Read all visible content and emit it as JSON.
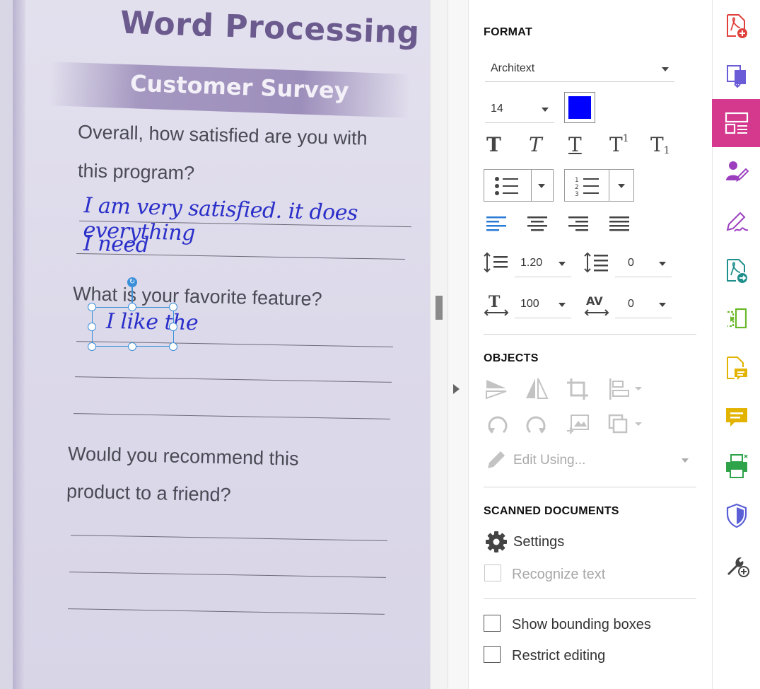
{
  "document": {
    "title": "Word Processing",
    "subtitle": "Customer Survey",
    "question1_line1": "Overall, how satisfied are you with",
    "question1_line2": "this program?",
    "answer1_line1": "I am very satisfied. it does everything",
    "answer1_line2": "I need",
    "question2": "What is your favorite feature?",
    "answer2": "I like the",
    "question3_line1": "Would you recommend this",
    "question3_line2": "product to a friend?"
  },
  "format": {
    "heading": "FORMAT",
    "font_family": "Architext",
    "font_size": "14",
    "text_color": "#0000ff",
    "line_spacing": "1.20",
    "paragraph_spacing": "0",
    "horizontal_scale": "100",
    "char_spacing": "0"
  },
  "objects": {
    "heading": "OBJECTS",
    "edit_using": "Edit Using..."
  },
  "scanned": {
    "heading": "SCANNED DOCUMENTS",
    "settings_label": "Settings",
    "recognize_label": "Recognize text"
  },
  "options": {
    "bounding_boxes_label": "Show bounding boxes",
    "restrict_editing_label": "Restrict editing"
  },
  "colors": {
    "accent": "#d4398e",
    "selection": "#3a8fd9",
    "handwriting": "#2a2fc9"
  }
}
